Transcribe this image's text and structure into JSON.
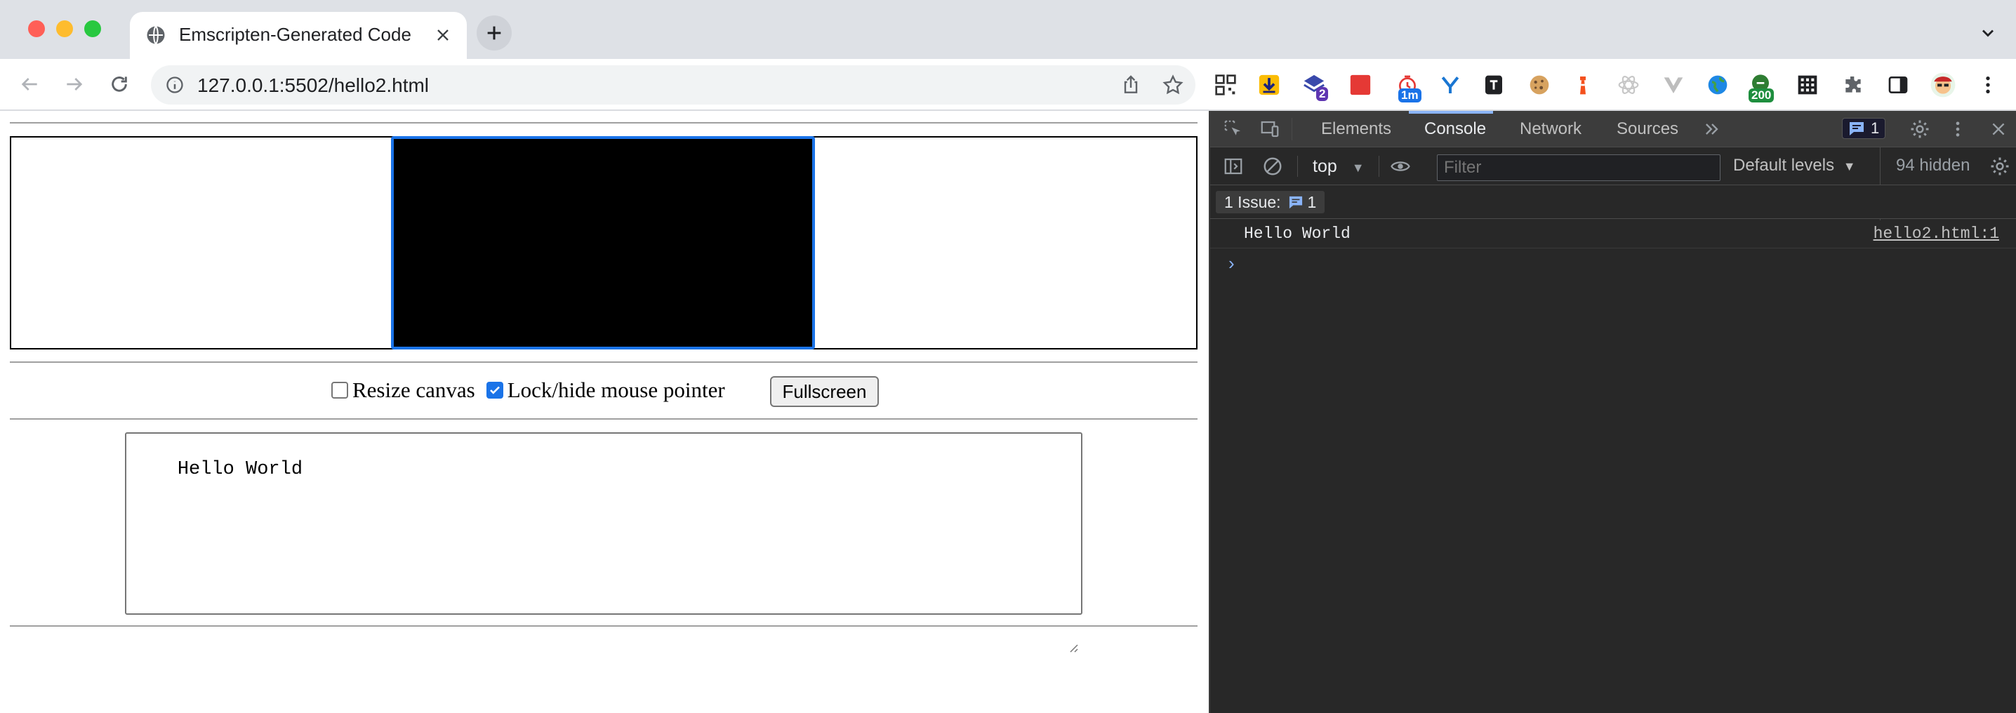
{
  "browser": {
    "tab_title": "Emscripten-Generated Code",
    "url": "127.0.0.1:5502/hello2.html",
    "extension_badges": {
      "ext3": "2",
      "ext5": "1m",
      "ext13": "200"
    }
  },
  "page": {
    "resize_label": "Resize canvas",
    "resize_checked": false,
    "lock_label": "Lock/hide mouse pointer",
    "lock_checked": true,
    "fullscreen_label": "Fullscreen",
    "output_text": "Hello World"
  },
  "devtools": {
    "tabs": [
      "Elements",
      "Console",
      "Network",
      "Sources"
    ],
    "active_tab": "Console",
    "issues_badge": "1",
    "context": "top",
    "filter_placeholder": "Filter",
    "levels": "Default levels",
    "hidden_count": "94 hidden",
    "issue_bar_label": "1 Issue:",
    "issue_bar_count": "1",
    "log": {
      "message": "Hello World",
      "source": "hello2.html:1"
    },
    "colors": {
      "accent": "#8ab4f8",
      "panel": "#282828",
      "toolbar": "#3c3c3c"
    }
  }
}
